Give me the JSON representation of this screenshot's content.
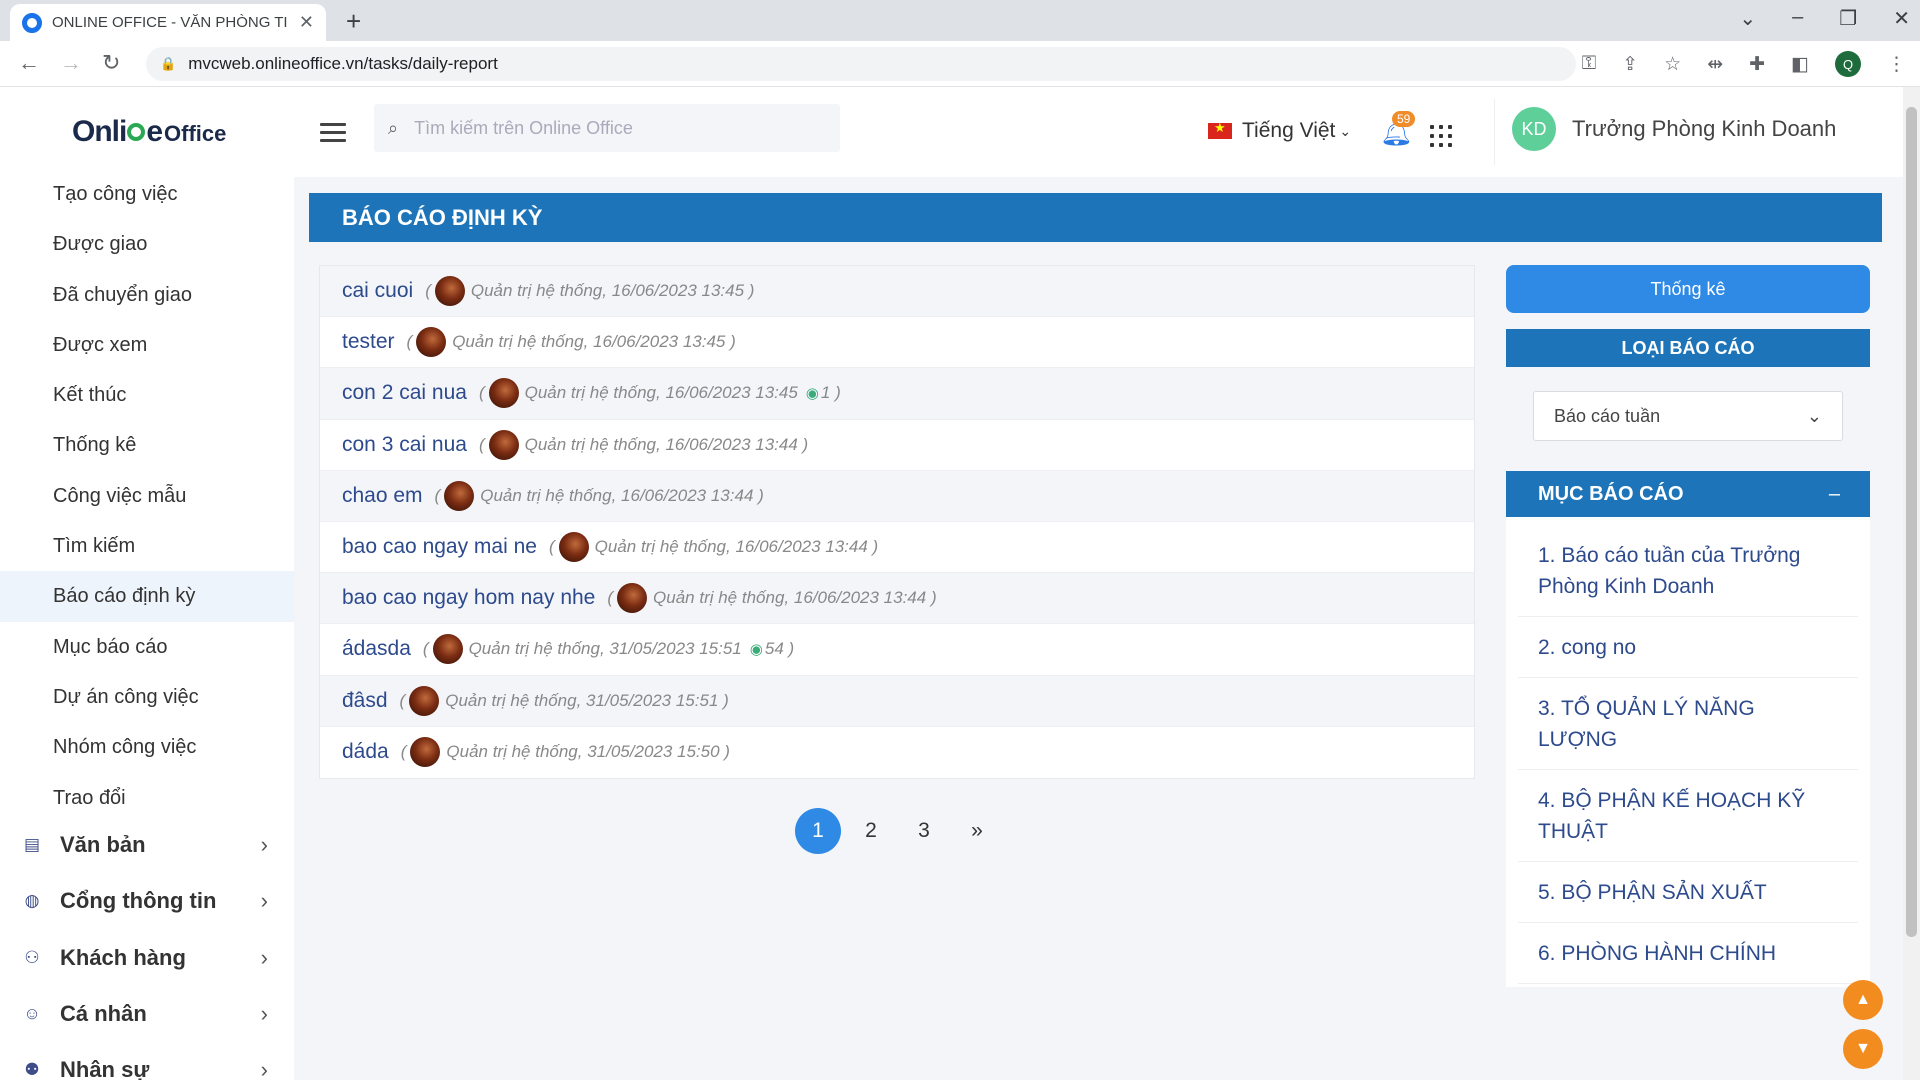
{
  "browser": {
    "tab_title": "ONLINE OFFICE - VĂN PHÒNG TI",
    "url": "mvcweb.onlineoffice.vn/tasks/daily-report",
    "profile_initial": "Q"
  },
  "logo": {
    "part1": "Onli",
    "part2": "e",
    "part3": "Office"
  },
  "sidebar": {
    "items": [
      {
        "label": "Tạo công việc"
      },
      {
        "label": "Được giao"
      },
      {
        "label": "Đã chuyển giao"
      },
      {
        "label": "Được xem"
      },
      {
        "label": "Kết thúc"
      },
      {
        "label": "Thống kê"
      },
      {
        "label": "Công việc mẫu"
      },
      {
        "label": "Tìm kiếm"
      },
      {
        "label": "Báo cáo định kỳ",
        "active": true
      },
      {
        "label": "Mục báo cáo"
      },
      {
        "label": "Dự án công việc"
      },
      {
        "label": "Nhóm công việc"
      },
      {
        "label": "Trao đổi"
      }
    ],
    "groups": [
      {
        "label": "Văn bản",
        "icon": "document-icon"
      },
      {
        "label": "Cổng thông tin",
        "icon": "globe-icon"
      },
      {
        "label": "Khách hàng",
        "icon": "customers-icon"
      },
      {
        "label": "Cá nhân",
        "icon": "smile-icon"
      },
      {
        "label": "Nhân sự",
        "icon": "people-icon"
      }
    ]
  },
  "topbar": {
    "search_placeholder": "Tìm kiếm trên Online Office",
    "language": "Tiếng Việt",
    "notification_count": "59",
    "user_initials": "KD",
    "user_name": "Trưởng Phòng Kinh Doanh"
  },
  "page_title": "BÁO CÁO ĐỊNH KỲ",
  "reports": [
    {
      "title": "cai cuoi",
      "author": "Quản trị hệ thống",
      "time": "16/06/2023 13:45",
      "views": ""
    },
    {
      "title": "tester",
      "author": "Quản trị hệ thống",
      "time": "16/06/2023 13:45",
      "views": ""
    },
    {
      "title": "con 2 cai nua",
      "author": "Quản trị hệ thống",
      "time": "16/06/2023 13:45",
      "views": "1"
    },
    {
      "title": "con 3 cai nua",
      "author": "Quản trị hệ thống",
      "time": "16/06/2023 13:44",
      "views": ""
    },
    {
      "title": "chao em",
      "author": "Quản trị hệ thống",
      "time": "16/06/2023 13:44",
      "views": ""
    },
    {
      "title": "bao cao ngay mai ne",
      "author": "Quản trị hệ thống",
      "time": "16/06/2023 13:44",
      "views": ""
    },
    {
      "title": "bao cao ngay hom nay nhe",
      "author": "Quản trị hệ thống",
      "time": "16/06/2023 13:44",
      "views": ""
    },
    {
      "title": "ádasda",
      "author": "Quản trị hệ thống",
      "time": "31/05/2023 15:51",
      "views": "54"
    },
    {
      "title": "đâsd",
      "author": "Quản trị hệ thống",
      "time": "31/05/2023 15:51",
      "views": ""
    },
    {
      "title": "dáda",
      "author": "Quản trị hệ thống",
      "time": "31/05/2023 15:50",
      "views": ""
    }
  ],
  "pagination": {
    "pages": [
      "1",
      "2",
      "3"
    ],
    "current": "1",
    "next": "»"
  },
  "right_panel": {
    "stat_button": "Thống kê",
    "type_header": "LOẠI BÁO CÁO",
    "type_selected": "Báo cáo tuần",
    "category_header": "MỤC BÁO CÁO",
    "categories": [
      "1. Báo cáo tuần của Trưởng Phòng Kinh Doanh",
      "2. cong no",
      "3. TỔ QUẢN LÝ NĂNG LƯỢNG",
      "4. BỘ PHẬN KẾ HOẠCH KỸ THUẬT",
      "5. BỘ PHẬN SẢN XUẤT",
      "6. PHÒNG HÀNH CHÍNH"
    ]
  },
  "colors": {
    "primary": "#1d74b8",
    "button": "#2f8ae5",
    "link": "#2d4a8c",
    "scroll_buttons": "#f28c1e"
  }
}
